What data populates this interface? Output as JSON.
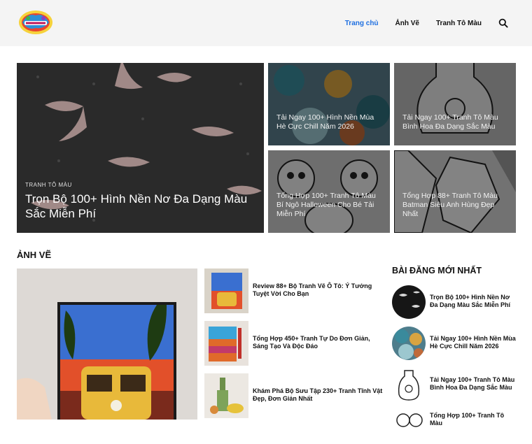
{
  "header": {
    "nav": [
      {
        "label": "Trang chủ",
        "active": true
      },
      {
        "label": "Ảnh Vẽ",
        "active": false
      },
      {
        "label": "Tranh Tô Màu",
        "active": false
      }
    ],
    "search_icon": "search-icon",
    "accent_color": "#1e6fe0"
  },
  "hero": {
    "main": {
      "category": "Tranh Tô Màu",
      "title": "Trọn Bộ 100+ Hình Nền Nơ Đa Dạng Màu Sắc Miễn Phí"
    },
    "tiles": [
      {
        "title": "Tải Ngay 100+ Hình Nền Mùa Hè Cực Chill Năm 2026"
      },
      {
        "title": "Tải Ngay 100+ Tranh Tô Màu Bình Hoa Đa Dạng Sắc Màu"
      },
      {
        "title": "Tổng Hợp 100+ Tranh Tô Màu Bí Ngô Halloween Cho Bé Tải Miễn Phí"
      },
      {
        "title": "Tổng Hợp 88+ Tranh Tô Màu Batman Siêu Anh Hùng Đẹp Nhất"
      }
    ]
  },
  "section": {
    "title": "ẢNH VẼ",
    "articles": [
      {
        "title": "Review 88+ Bộ Tranh Vẽ Ô Tô: Ý Tưởng Tuyệt Vời Cho Bạn"
      },
      {
        "title": "Tổng Hợp 450+ Tranh Tự Do Đơn Giản, Sáng Tạo Và Độc Đáo"
      },
      {
        "title": "Khám Phá Bộ Sưu Tập 230+ Tranh Tĩnh Vật Đẹp, Đơn Giản Nhất"
      }
    ]
  },
  "sidebar": {
    "title": "BÀI ĐĂNG MỚI NHẤT",
    "items": [
      {
        "title": "Trọn Bộ 100+ Hình Nền Nơ Đa Dạng Màu Sắc Miễn Phí"
      },
      {
        "title": "Tải Ngay 100+ Hình Nền Mùa Hè Cực Chill Năm 2026"
      },
      {
        "title": "Tải Ngay 100+ Tranh Tô Màu Bình Hoa Đa Dạng Sắc Màu"
      },
      {
        "title": "Tổng Hợp 100+ Tranh Tô Màu"
      }
    ]
  }
}
